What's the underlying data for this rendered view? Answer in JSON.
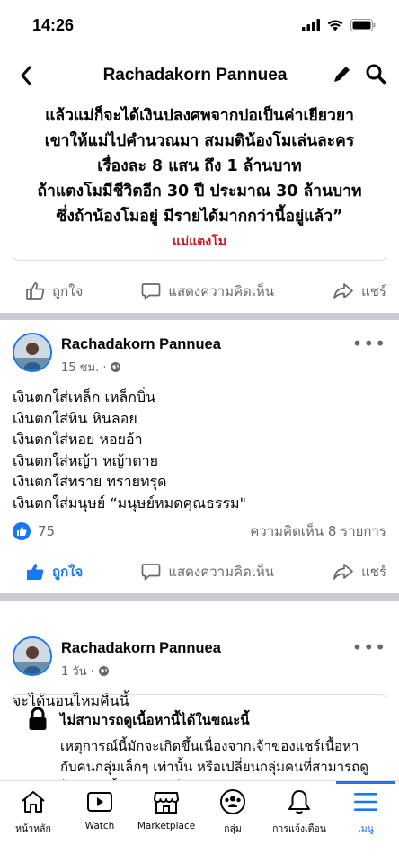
{
  "status_bar": {
    "time": "14:26"
  },
  "header": {
    "title": "Rachadakorn Pannuea"
  },
  "image_post": {
    "quote_lines": [
      "แล้วแม่ก็จะได้เงินปลงศพจากปอเป็นค่าเยียวยา",
      "เขาให้แม่ไปคำนวณมา สมมติน้องโมเล่นละคร",
      "เรื่องละ 8 แสน ถึง 1 ล้านบาท",
      "ถ้าแตงโมมีชีวิตอีก 30 ปี ประมาณ 30 ล้านบาท",
      "ซึ่งถ้าน้องโมอยู่ มีรายได้มากกว่านี้อยู่แล้ว”"
    ],
    "quote_source": "แม่แตงโม"
  },
  "actions": {
    "like": "ถูกใจ",
    "comment": "แสดงความคิดเห็น",
    "share": "แชร์"
  },
  "post1": {
    "author": "Rachadakorn Pannuea",
    "time": "15 ชม. ·",
    "lines": [
      "เงินตกใส่เหล็ก เหล็กบิ่น",
      "เงินตกใส่หิน หินลอย",
      "เงินตกใส่หอย หอยอ้า",
      "เงินตกใส่หญ้า หญ้าตาย",
      "เงินตกใส่ทราย ทรายทรุด",
      "เงินตกใส่มนุษย์ “มนุษย์หมดคุณธรรม\""
    ],
    "likes": "75",
    "comments": "ความคิดเห็น 8 รายการ"
  },
  "post2": {
    "author": "Rachadakorn Pannuea",
    "time": "1 วัน ·",
    "text": "จะได้นอนไหมคืนนี้",
    "restricted_title": "ไม่สามารถดูเนื้อหานี้ได้ในขณะนี้",
    "restricted_text": "เหตุการณ์นี้มักจะเกิดขึ้นเนื่องจากเจ้าของแชร์เนื้อหากับคนกลุ่มเล็กๆ เท่านั้น หรือเปลี่ยนกลุ่มคนที่สามารถดูได้ หรือเนื้อหาถูกลบไปแล้ว"
  },
  "tabs": [
    {
      "label": "หน้าหลัก",
      "icon": "home-icon"
    },
    {
      "label": "Watch",
      "icon": "watch-icon"
    },
    {
      "label": "Marketplace",
      "icon": "marketplace-icon"
    },
    {
      "label": "กลุ่ม",
      "icon": "groups-icon"
    },
    {
      "label": "การแจ้งเตือน",
      "icon": "bell-icon"
    },
    {
      "label": "เมนู",
      "icon": "menu-icon"
    }
  ],
  "colors": {
    "accent": "#1877f2",
    "quote_source": "#c8161d",
    "secondary_text": "#65676b"
  }
}
